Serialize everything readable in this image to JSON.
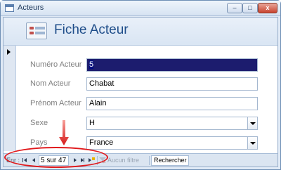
{
  "window": {
    "title": "Acteurs",
    "controls": {
      "minimize": "–",
      "maximize": "□",
      "close": "x"
    }
  },
  "form": {
    "title": "Fiche Acteur",
    "fields": {
      "numero": {
        "label": "Numéro Acteur",
        "value": "5"
      },
      "nom": {
        "label": "Nom Acteur",
        "value": "Chabat"
      },
      "prenom": {
        "label": "Prénom Acteur",
        "value": "Alain"
      },
      "sexe": {
        "label": "Sexe",
        "value": "H"
      },
      "pays": {
        "label": "Pays",
        "value": "France"
      }
    }
  },
  "navigation": {
    "label": "Enr :",
    "record_counter": "5 sur 47",
    "filter_label": "Aucun filtre",
    "search_label": "Rechercher"
  },
  "colors": {
    "annotation": "#e0191c",
    "title": "#1f4e8a"
  },
  "icons": [
    "app-icon",
    "form-icon",
    "record-selector-arrow",
    "first-record-icon",
    "prev-record-icon",
    "next-record-icon",
    "last-record-icon",
    "new-record-icon",
    "filter-icon",
    "dropdown-arrow-icon"
  ]
}
